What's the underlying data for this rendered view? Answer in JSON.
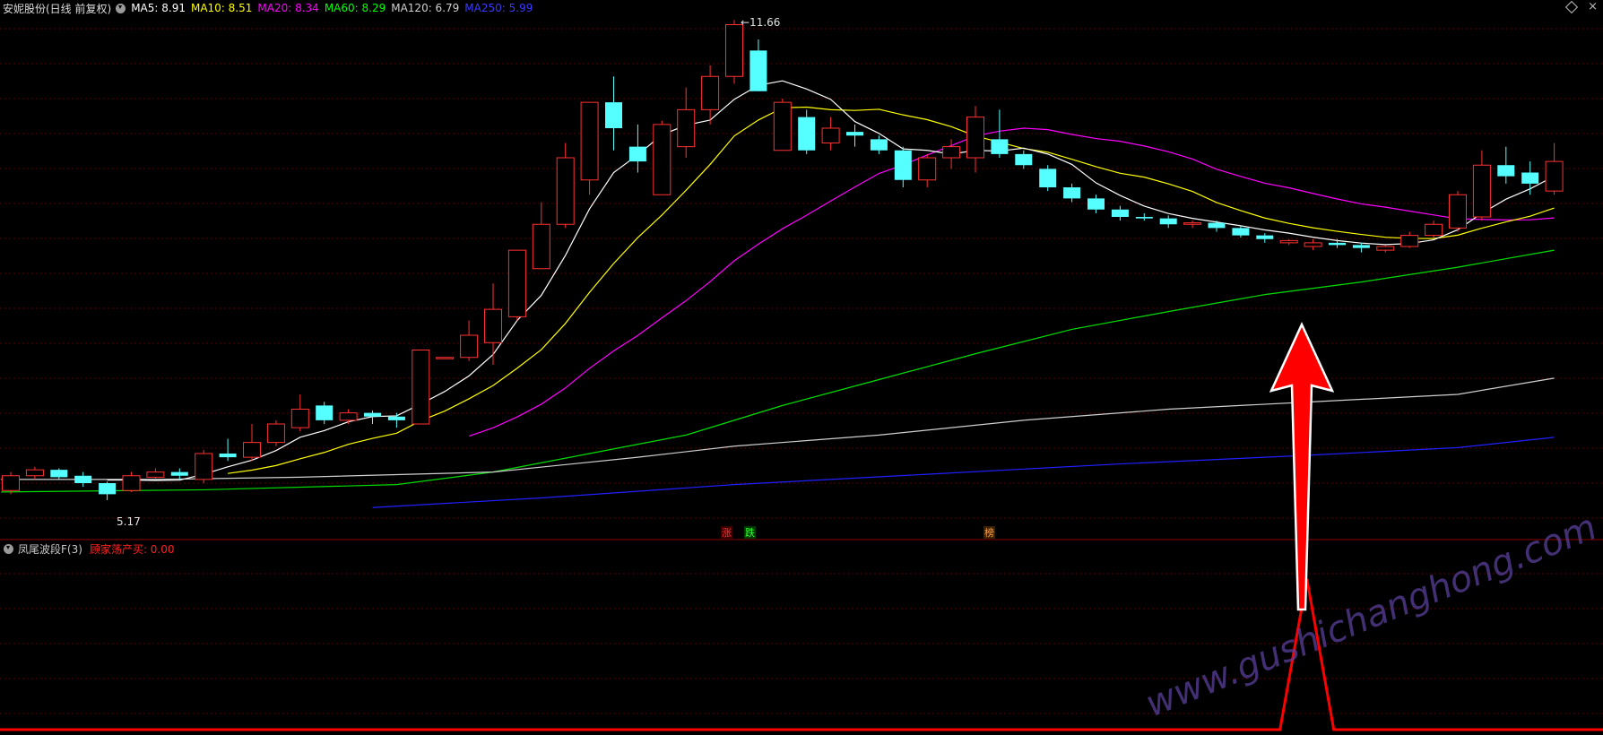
{
  "header": {
    "title": "安妮股份(日线 前复权)",
    "ma": [
      {
        "label": "MA5: 8.91",
        "color": "#ffffff"
      },
      {
        "label": "MA10: 8.51",
        "color": "#ffff00"
      },
      {
        "label": "MA20: 8.34",
        "color": "#ff00ff"
      },
      {
        "label": "MA60: 8.29",
        "color": "#00ff00"
      },
      {
        "label": "MA120: 6.79",
        "color": "#d0d0d0"
      },
      {
        "label": "MA250: 5.99",
        "color": "#3a3aff"
      }
    ],
    "close_label": "×"
  },
  "indicator": {
    "name": "凤尾波段F(3)",
    "value_label": "顾家荡产买: 0.00",
    "value_color": "#ff2020"
  },
  "annotations": {
    "high": "11.66",
    "low": "5.17",
    "marks": [
      {
        "text": "涨",
        "color": "#ff3030",
        "bg": "#3a0000"
      },
      {
        "text": "跌",
        "color": "#30ff30",
        "bg": "#003a00"
      },
      {
        "text": "榜",
        "color": "#ffa040",
        "bg": "#3a2000"
      }
    ]
  },
  "watermark": "www.gushichanghong.com",
  "colors": {
    "up": "#ff3030",
    "down": "#55ffff",
    "grid": "#5a0000",
    "arrow": "#ff0000"
  },
  "chart_data": {
    "type": "candlestick",
    "candles": [
      [
        5.3,
        5.5,
        5.55,
        5.25
      ],
      [
        5.5,
        5.58,
        5.62,
        5.45
      ],
      [
        5.58,
        5.48,
        5.6,
        5.45
      ],
      [
        5.5,
        5.4,
        5.55,
        5.35
      ],
      [
        5.4,
        5.25,
        5.42,
        5.17
      ],
      [
        5.3,
        5.5,
        5.55,
        5.28
      ],
      [
        5.48,
        5.55,
        5.6,
        5.45
      ],
      [
        5.55,
        5.5,
        5.6,
        5.45
      ],
      [
        5.45,
        5.8,
        5.85,
        5.4
      ],
      [
        5.8,
        5.75,
        6.0,
        5.7
      ],
      [
        5.75,
        5.95,
        6.2,
        5.7
      ],
      [
        5.95,
        6.2,
        6.25,
        5.9
      ],
      [
        6.15,
        6.4,
        6.6,
        6.1
      ],
      [
        6.45,
        6.25,
        6.5,
        6.2
      ],
      [
        6.25,
        6.35,
        6.4,
        6.2
      ],
      [
        6.35,
        6.3,
        6.38,
        6.2
      ],
      [
        6.3,
        6.25,
        6.35,
        6.15
      ],
      [
        6.2,
        7.2,
        7.2,
        6.2
      ],
      [
        7.1,
        7.1,
        7.1,
        7.1
      ],
      [
        7.1,
        7.4,
        7.6,
        7.05
      ],
      [
        7.3,
        7.75,
        8.1,
        7.0
      ],
      [
        7.65,
        8.55,
        8.55,
        7.6
      ],
      [
        8.3,
        8.9,
        9.2,
        8.3
      ],
      [
        8.9,
        9.8,
        10.0,
        8.85
      ],
      [
        9.5,
        10.55,
        10.55,
        9.3
      ],
      [
        10.55,
        10.2,
        10.9,
        9.9
      ],
      [
        9.95,
        9.75,
        10.25,
        9.6
      ],
      [
        9.3,
        10.25,
        10.3,
        9.3
      ],
      [
        9.95,
        10.45,
        10.75,
        9.8
      ],
      [
        10.45,
        10.9,
        11.05,
        10.25
      ],
      [
        10.9,
        11.6,
        11.66,
        10.8
      ],
      [
        11.25,
        10.7,
        11.4,
        10.7
      ],
      [
        9.9,
        10.55,
        10.6,
        9.9
      ],
      [
        10.35,
        9.9,
        10.45,
        9.85
      ],
      [
        10.0,
        10.2,
        10.35,
        9.9
      ],
      [
        10.15,
        10.1,
        10.25,
        9.95
      ],
      [
        10.05,
        9.9,
        10.1,
        9.85
      ],
      [
        9.9,
        9.5,
        9.95,
        9.4
      ],
      [
        9.5,
        9.8,
        9.85,
        9.4
      ],
      [
        9.8,
        9.95,
        10.05,
        9.65
      ],
      [
        9.8,
        10.35,
        10.5,
        9.6
      ],
      [
        10.05,
        9.85,
        10.45,
        9.8
      ],
      [
        9.85,
        9.7,
        9.9,
        9.65
      ],
      [
        9.65,
        9.4,
        9.7,
        9.35
      ],
      [
        9.4,
        9.25,
        9.45,
        9.2
      ],
      [
        9.25,
        9.1,
        9.3,
        9.05
      ],
      [
        9.1,
        9.0,
        9.15,
        8.95
      ],
      [
        9.0,
        8.98,
        9.05,
        8.95
      ],
      [
        8.98,
        8.9,
        9.02,
        8.85
      ],
      [
        8.9,
        8.92,
        8.95,
        8.85
      ],
      [
        8.92,
        8.85,
        8.95,
        8.8
      ],
      [
        8.85,
        8.75,
        8.88,
        8.72
      ],
      [
        8.75,
        8.7,
        8.78,
        8.65
      ],
      [
        8.65,
        8.68,
        8.7,
        8.62
      ],
      [
        8.6,
        8.65,
        8.7,
        8.55
      ],
      [
        8.65,
        8.62,
        8.7,
        8.58
      ],
      [
        8.62,
        8.58,
        8.65,
        8.52
      ],
      [
        8.55,
        8.6,
        8.62,
        8.52
      ],
      [
        8.6,
        8.75,
        8.8,
        8.58
      ],
      [
        8.75,
        8.9,
        8.95,
        8.72
      ],
      [
        8.85,
        9.3,
        9.35,
        8.8
      ],
      [
        9.0,
        9.7,
        9.9,
        8.95
      ],
      [
        9.7,
        9.55,
        9.95,
        9.45
      ],
      [
        9.6,
        9.45,
        9.75,
        9.3
      ],
      [
        9.35,
        9.75,
        10.0,
        9.3
      ]
    ],
    "indicator": {
      "name": "顾家荡产买",
      "peak_candle": 53,
      "peak_value": 1
    }
  }
}
